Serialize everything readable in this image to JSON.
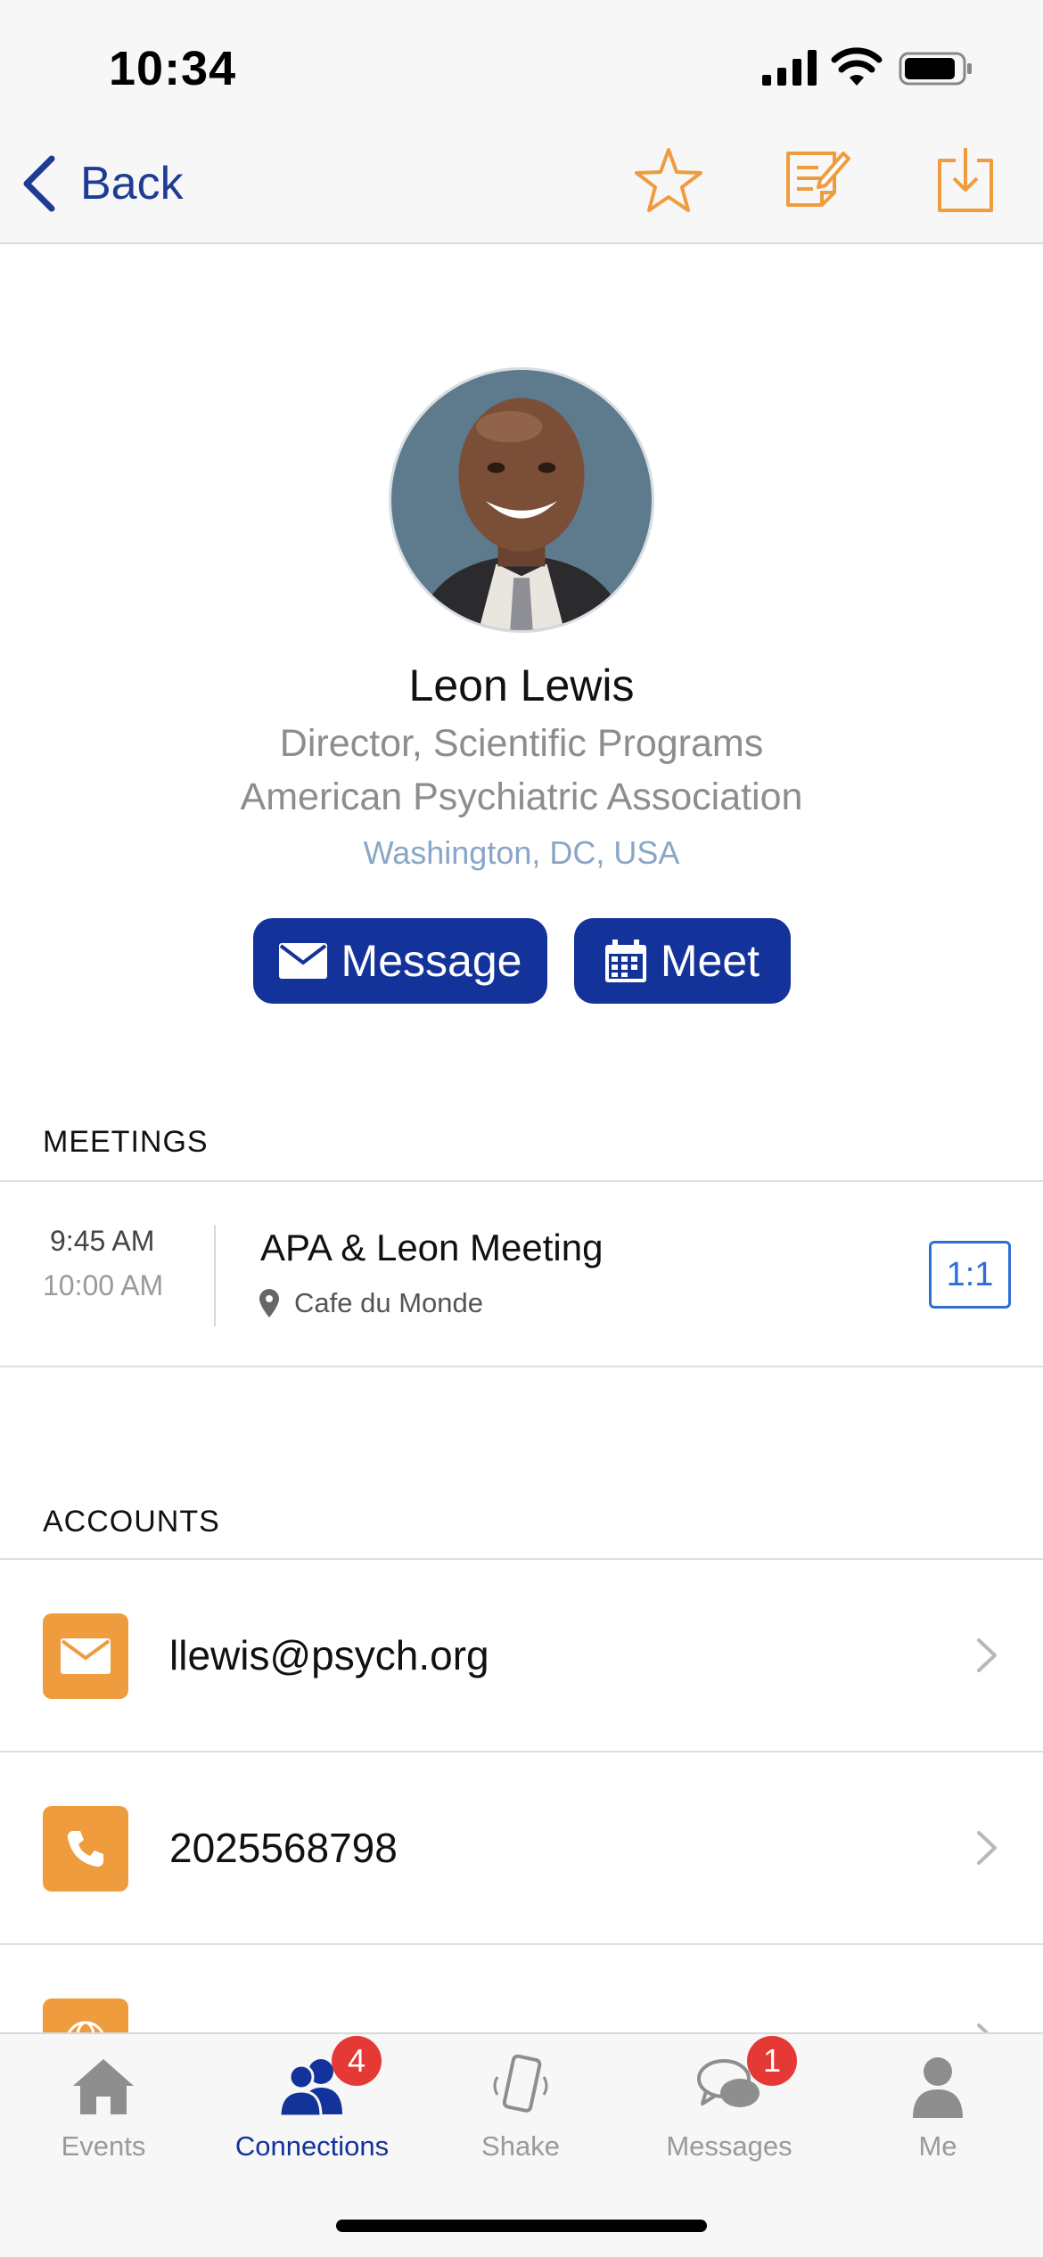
{
  "status_bar": {
    "time": "10:34"
  },
  "nav": {
    "back_label": "Back"
  },
  "profile": {
    "name": "Leon Lewis",
    "title": "Director, Scientific Programs",
    "organization": "American Psychiatric Association",
    "location": "Washington, DC, USA",
    "message_label": "Message",
    "meet_label": "Meet"
  },
  "meetings": {
    "header": "MEETINGS",
    "items": [
      {
        "start": "9:45 AM",
        "end": "10:00 AM",
        "title": "APA & Leon Meeting",
        "location": "Cafe du Monde",
        "type": "1:1"
      }
    ]
  },
  "accounts": {
    "header": "ACCOUNTS",
    "items": [
      {
        "icon": "email-icon",
        "value": "llewis@psych.org"
      },
      {
        "icon": "phone-icon",
        "value": "2025568798"
      }
    ]
  },
  "tabs": [
    {
      "label": "Events",
      "icon": "home-icon",
      "active": false
    },
    {
      "label": "Connections",
      "icon": "people-icon",
      "active": true,
      "badge": "4"
    },
    {
      "label": "Shake",
      "icon": "phone-shake-icon",
      "active": false
    },
    {
      "label": "Messages",
      "icon": "chat-icon",
      "active": false,
      "badge": "1"
    },
    {
      "label": "Me",
      "icon": "person-icon",
      "active": false
    }
  ],
  "colors": {
    "primary": "#13339a",
    "accent": "#ef9c3f",
    "link_blue": "#2f6fd3",
    "badge_red": "#e53935"
  }
}
